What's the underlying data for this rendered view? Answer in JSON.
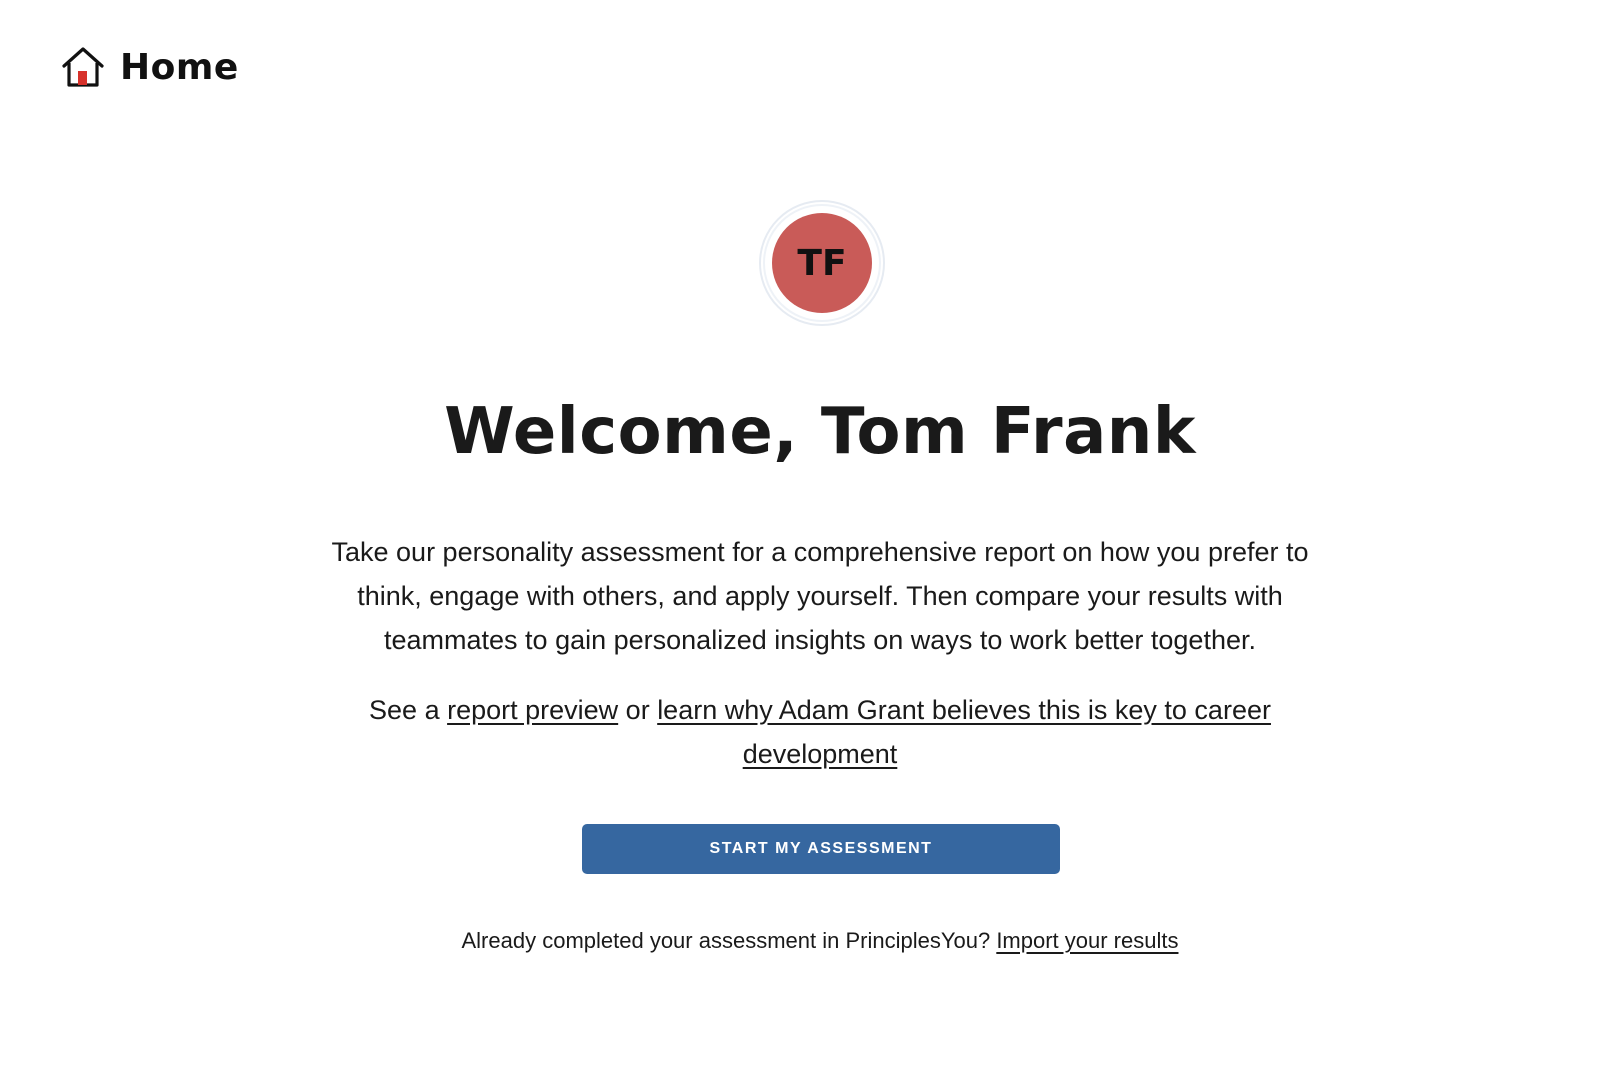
{
  "header": {
    "title": "Home",
    "icon": "home-icon"
  },
  "colors": {
    "accent_red": "#d7322b",
    "avatar_bg": "#c95b58",
    "button_bg": "#3667a0",
    "ring": "#dfe6ef"
  },
  "profile": {
    "initials": "TF"
  },
  "main": {
    "welcome": "Welcome, Tom Frank",
    "intro": "Take our personality assessment for a comprehensive report on how you prefer to think, engage with others, and apply yourself. Then compare your results with teammates to gain personalized insights on ways to work better together.",
    "links": {
      "prefix": "See a ",
      "report_preview": "report preview",
      "connector": " or ",
      "learn_why": "learn why Adam Grant believes this is key to career development"
    },
    "start_button": "START MY ASSESSMENT",
    "import": {
      "prefix": "Already completed your assessment in PrinciplesYou? ",
      "link": "Import your results"
    }
  }
}
